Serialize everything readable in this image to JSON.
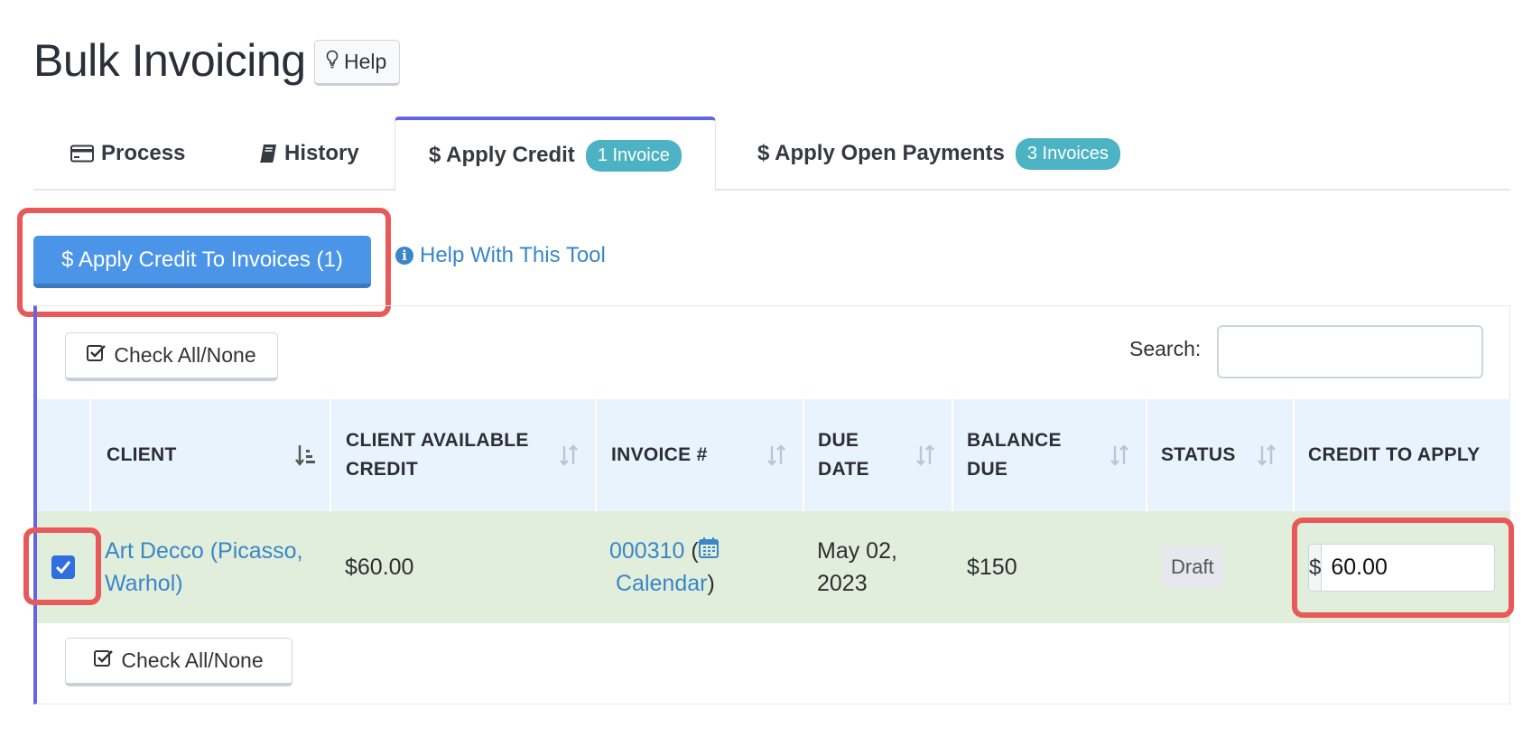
{
  "header": {
    "title": "Bulk Invoicing",
    "help_label": "Help"
  },
  "tabs": [
    {
      "label": "Process",
      "icon": "credit-card-icon"
    },
    {
      "label": "History",
      "icon": "book-icon"
    },
    {
      "label": "$ Apply Credit",
      "badge": "1 Invoice",
      "active": true
    },
    {
      "label": "$ Apply Open Payments",
      "badge": "3 Invoices"
    }
  ],
  "toolbar": {
    "apply_label": "$ Apply Credit To Invoices (1)",
    "help_tool_label": "Help With This Tool"
  },
  "table_controls": {
    "check_all_label": "Check All/None",
    "search_label": "Search:",
    "search_value": ""
  },
  "table": {
    "columns": [
      "CLIENT",
      "CLIENT AVAILABLE CREDIT",
      "INVOICE #",
      "DUE DATE",
      "BALANCE DUE",
      "STATUS",
      "CREDIT TO APPLY"
    ],
    "rows": [
      {
        "checked": true,
        "client": "Art Decco (Picasso, Warhol)",
        "available_credit": "$60.00",
        "invoice_number": "000310",
        "calendar_label": "Calendar",
        "due_date": "May 02, 2023",
        "balance_due": "$150",
        "status": "Draft",
        "currency_symbol": "$",
        "credit_to_apply": "60.00"
      }
    ]
  },
  "colors": {
    "accent": "#4b95e8",
    "active_tab_border": "#6366e0",
    "badge": "#4cb3c4",
    "highlight": "#e8595a",
    "header_bg": "#e8f3fd",
    "row_bg": "#e1eedb",
    "link": "#3a86c8"
  }
}
